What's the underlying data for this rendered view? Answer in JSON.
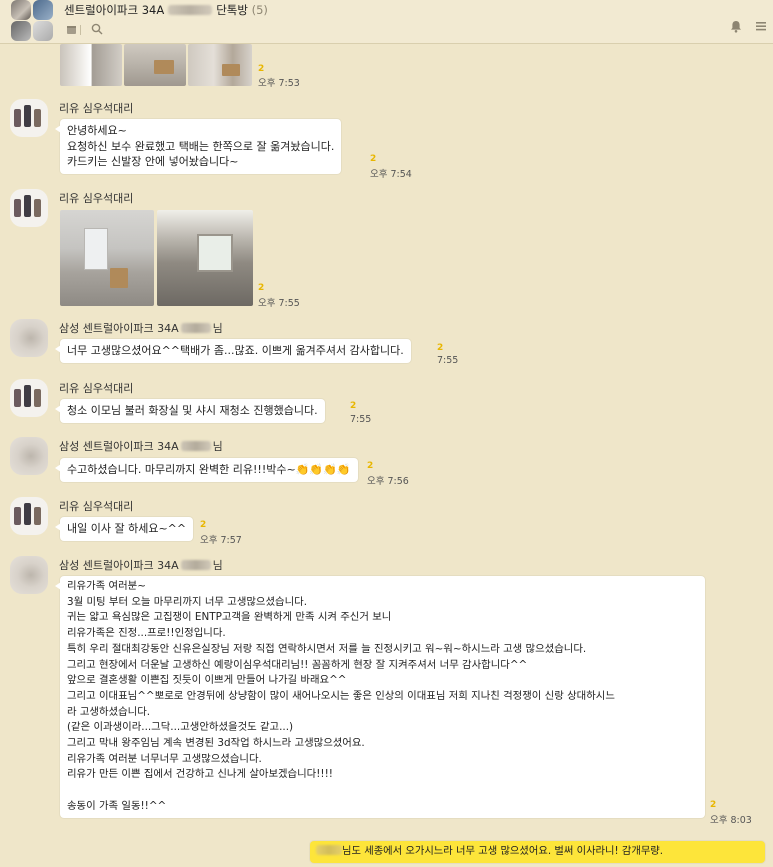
{
  "header": {
    "title": "센트럴아이파크 34A",
    "chat_type": "단톡방",
    "member_count": "(5)",
    "icons": [
      "calendar-icon",
      "search-icon",
      "bell-icon",
      "menu-icon"
    ]
  },
  "colors": {
    "background": "#efe6c9",
    "bubble_other": "#ffffff",
    "bubble_mine": "#fde53a",
    "unread_badge": "#e8b600"
  },
  "messages": [
    {
      "id": "m0",
      "type": "photos",
      "unread": "2",
      "time": "오후 7:53"
    },
    {
      "id": "m1",
      "sender": "리유 심우석대리",
      "lines": [
        "안녕하세요~",
        "요청하신 보수 완료했고 택배는 한쪽으로 잘 옮겨놨습니다.",
        "카드키는 신발장 안에 넣어놨습니다~"
      ],
      "unread": "2",
      "time": "오후 7:54"
    },
    {
      "id": "m2",
      "sender": "리유 심우석대리",
      "type": "photos",
      "unread": "2",
      "time": "오후 7:55"
    },
    {
      "id": "m3",
      "sender_prefix": "삼성 센트럴아이파크 34A",
      "sender_suffix": "님",
      "lines": [
        "너무 고생많으셨어요^^택배가 좀...많죠. 이쁘게 옮겨주셔서 감사합니다."
      ],
      "unread": "2",
      "time": "7:55"
    },
    {
      "id": "m4",
      "sender": "리유 심우석대리",
      "lines": [
        "청소 이모님 불러 화장실 및 샤시 재청소 진행했습니다."
      ],
      "unread": "2",
      "time": "7:55"
    },
    {
      "id": "m5",
      "sender_prefix": "삼성 센트럴아이파크 34A",
      "sender_suffix": "님",
      "lines": [
        "수고하셨습니다. 마무리까지 완벽한 리유!!!박수~👏👏👏👏"
      ],
      "unread": "2",
      "time": "오후 7:56"
    },
    {
      "id": "m6",
      "sender": "리유 심우석대리",
      "lines": [
        "내일 이사 잘 하세요~^^"
      ],
      "unread": "2",
      "time": "오후 7:57"
    },
    {
      "id": "m7",
      "sender_prefix": "삼성 센트럴아이파크 34A",
      "sender_suffix": "님",
      "lines": [
        "리유가족 여러분~",
        "3월 미팅 부터 오늘 마무리까지 너무 고생많으셨습니다.",
        "귀는 얇고 욕심많은 고집쟁이 ENTP고객을 완벽하게 만족 시켜 주신거 보니",
        "리유가족은 진정...프로!!인정입니다.",
        "특히 우리 절대최강동안 신유은실장님 저랑 직접 연락하시면서 저를 늘 진정시키고 워~워~하시느라 고생 많으셨습니다.",
        "그리고 현장에서 더운날 고생하신 예랑이심우석대리님!! 꼼꼼하게 현장 잘 지켜주셔서 너무 감사합니다^^",
        "앞으로 결혼생활 이쁜집 짓듯이 이쁘게 만들어 나가길 바래요^^",
        "그리고 이대표님^^뽀로로 안경뒤에 상냥함이 많이 새어나오시는 좋은 인상의 이대표님 저희 지나친 걱정쟁이 신랑 상대하시느",
        "라 고생하셨습니다.",
        "(같은 이과생이라...그닥...고생안하셨을것도 같고...)",
        "그리고 막내 왕주임님 계속 변경된 3d작업 하시느라 고생많으셨어요.",
        "리유가족 여러분 너무너무 고생많으셨습니다.",
        "리유가 만든 이쁜 집에서 건강하고 신나게 살아보겠습니다!!!!",
        "",
        "송동이 가족 일동!!^^"
      ],
      "unread": "2",
      "time": "오후 8:03"
    },
    {
      "id": "m8",
      "mine": true,
      "text_after_blur": "님도 세종에서 오가시느라 너무 고생 많으셨어요. 벌써 이사라니! 감개무량."
    }
  ]
}
